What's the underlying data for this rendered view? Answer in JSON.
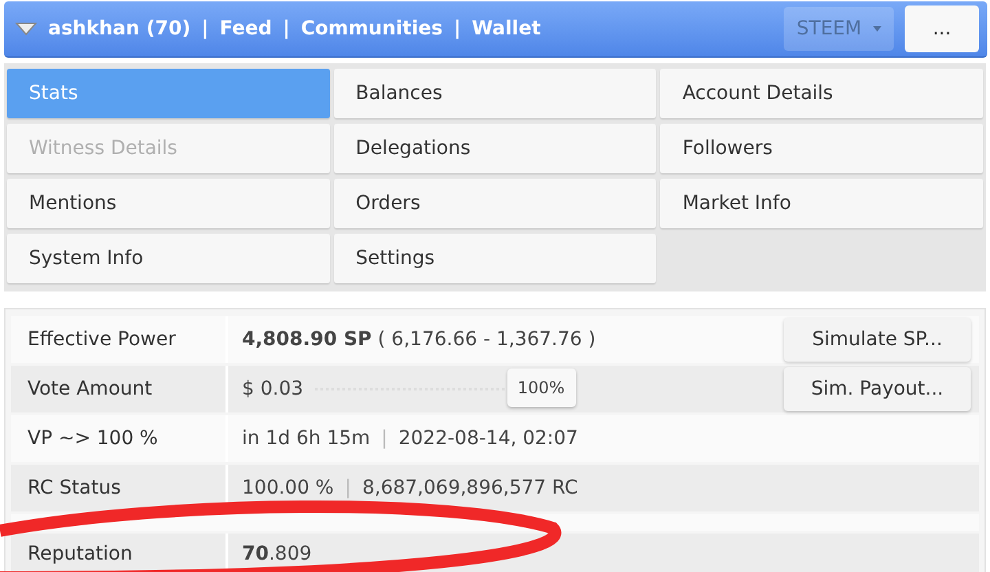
{
  "header": {
    "user": "ashkhan (70)",
    "links": [
      "Feed",
      "Communities",
      "Wallet"
    ],
    "separator": "|",
    "currency": "STEEM",
    "more_button": "..."
  },
  "menu": [
    {
      "label": "Stats",
      "selected": true,
      "disabled": false
    },
    {
      "label": "Balances",
      "selected": false,
      "disabled": false
    },
    {
      "label": "Account Details",
      "selected": false,
      "disabled": false
    },
    {
      "label": "Witness Details",
      "selected": false,
      "disabled": true
    },
    {
      "label": "Delegations",
      "selected": false,
      "disabled": false
    },
    {
      "label": "Followers",
      "selected": false,
      "disabled": false
    },
    {
      "label": "Mentions",
      "selected": false,
      "disabled": false
    },
    {
      "label": "Orders",
      "selected": false,
      "disabled": false
    },
    {
      "label": "Market Info",
      "selected": false,
      "disabled": false
    },
    {
      "label": "System Info",
      "selected": false,
      "disabled": false
    },
    {
      "label": "Settings",
      "selected": false,
      "disabled": false
    }
  ],
  "stats": [
    {
      "kind": "text",
      "label": "Effective Power",
      "value": "**4,808.90 SP** ( 6,176.66 - 1,367.76 )",
      "button": "Simulate SP..."
    },
    {
      "kind": "slider",
      "label": "Vote Amount",
      "value": "$ 0.03",
      "level": 1,
      "reading": "100%",
      "button": "Sim. Payout..."
    },
    {
      "kind": "pair",
      "label": "VP ~> 100 %",
      "value": "in 1d 6h 15m",
      "separator": "|",
      "value_2": "2022-08-14, 02:07"
    },
    {
      "kind": "pair",
      "label": "RC Status",
      "value": "100.00 %",
      "separator": "|",
      "value_2": "8,687,069,896,577 RC"
    },
    {
      "kind": "spacer"
    },
    {
      "kind": "text",
      "label": "Reputation",
      "value": "**70**.809"
    }
  ]
}
